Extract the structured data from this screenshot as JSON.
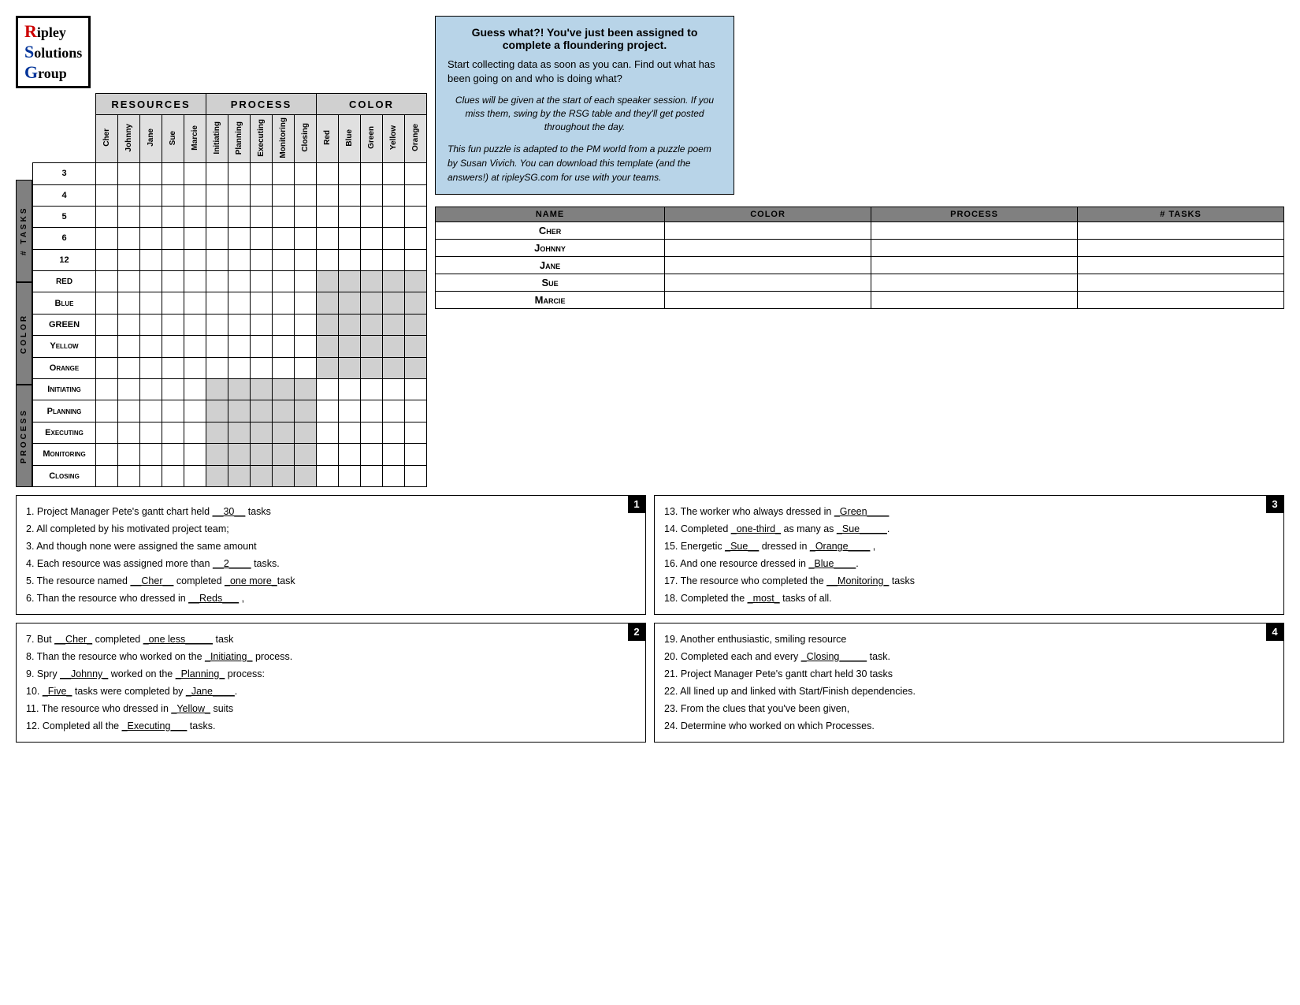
{
  "logo": {
    "line1": "ipley",
    "line2": "olutions",
    "line3": "roup"
  },
  "headers": {
    "resources": "Resources",
    "process": "Process",
    "color": "Color"
  },
  "columns": {
    "resources": [
      "Cher",
      "Johnny",
      "Jane",
      "Sue",
      "Marcie"
    ],
    "process": [
      "Initiating",
      "Planning",
      "Executing",
      "Monitoring",
      "Closing"
    ],
    "color": [
      "Red",
      "Blue",
      "Green",
      "Yellow",
      "Orange"
    ]
  },
  "rows": {
    "tasks": {
      "label": "# Tasks",
      "values": [
        "3",
        "4",
        "5",
        "6",
        "12"
      ]
    },
    "color": {
      "label": "Color",
      "values": [
        "Red",
        "Blue",
        "Green",
        "Yellow",
        "Orange"
      ]
    },
    "process": {
      "label": "Process",
      "values": [
        "Initiating",
        "Planning",
        "Executing",
        "Monitoring",
        "Closing"
      ]
    }
  },
  "info_box": {
    "title": "Guess what?! You've just been assigned to complete a floundering project.",
    "body": "Start collecting data as soon as you can.  Find out what has been going on and who is doing what?",
    "italic1": "Clues will be given at the start of each speaker session.  If you miss them, swing by the RSG table and they'll get posted throughout the day.",
    "italic2": "This fun puzzle is adapted to the PM world from a puzzle poem by Susan Vivich.  You can download this template (and the answers!) at ripleySG.com for use with your teams."
  },
  "answer_table": {
    "headers": [
      "Name",
      "Color",
      "Process",
      "# Tasks"
    ],
    "rows": [
      {
        "name": "Cher",
        "color": "",
        "process": "",
        "tasks": ""
      },
      {
        "name": "Johnny",
        "color": "",
        "process": "",
        "tasks": ""
      },
      {
        "name": "Jane",
        "color": "",
        "process": "",
        "tasks": ""
      },
      {
        "name": "Sue",
        "color": "",
        "process": "",
        "tasks": ""
      },
      {
        "name": "Marcie",
        "color": "",
        "process": "",
        "tasks": ""
      }
    ]
  },
  "clues": {
    "box1": {
      "number": "1",
      "lines": [
        "1.  Project Manager Pete’s gantt chart held __30__ tasks",
        "2.  All completed by his motivated project team;",
        "3.  And though none were assigned the same amount",
        "4.  Each resource was assigned more than __2____ tasks.",
        "5.  The resource named __Cher__ completed _one more_task",
        "6.  Than the resource who dressed in __Reds___ ,"
      ]
    },
    "box2": {
      "number": "2",
      "lines": [
        "7.  But __Cher_ completed _one less_____ task",
        "8.  Than the resource who worked on the _Initiating_ process.",
        "9.  Spry __Johnny_ worked on the _Planning_ process:",
        "10. _Five_ tasks were completed by _Jane____.",
        "11. The resource who dressed in _Yellow_ suits",
        "12. Completed all the _Executing___ tasks."
      ]
    },
    "box3": {
      "number": "3",
      "lines": [
        "13. The worker who always dressed in _Green____",
        "14. Completed _one-third_ as many as _Sue_____.",
        "15. Energetic _Sue__ dressed in _Orange____ ,",
        "16. And one resource dressed in _Blue____.",
        "17. The resource who completed the __Monitoring_ tasks",
        "18. Completed the _most_ tasks of all."
      ]
    },
    "box4": {
      "number": "4",
      "lines": [
        "19. Another enthusiastic, smiling resource",
        "20. Completed each and every _Closing____ task.",
        "21. Project Manager Pete’s gantt chart held 30 tasks",
        "22. All lined up and linked with Start/Finish dependencies.",
        "23. From the clues that you’ve been given,",
        "24. Determine who worked on which Processes."
      ]
    }
  }
}
